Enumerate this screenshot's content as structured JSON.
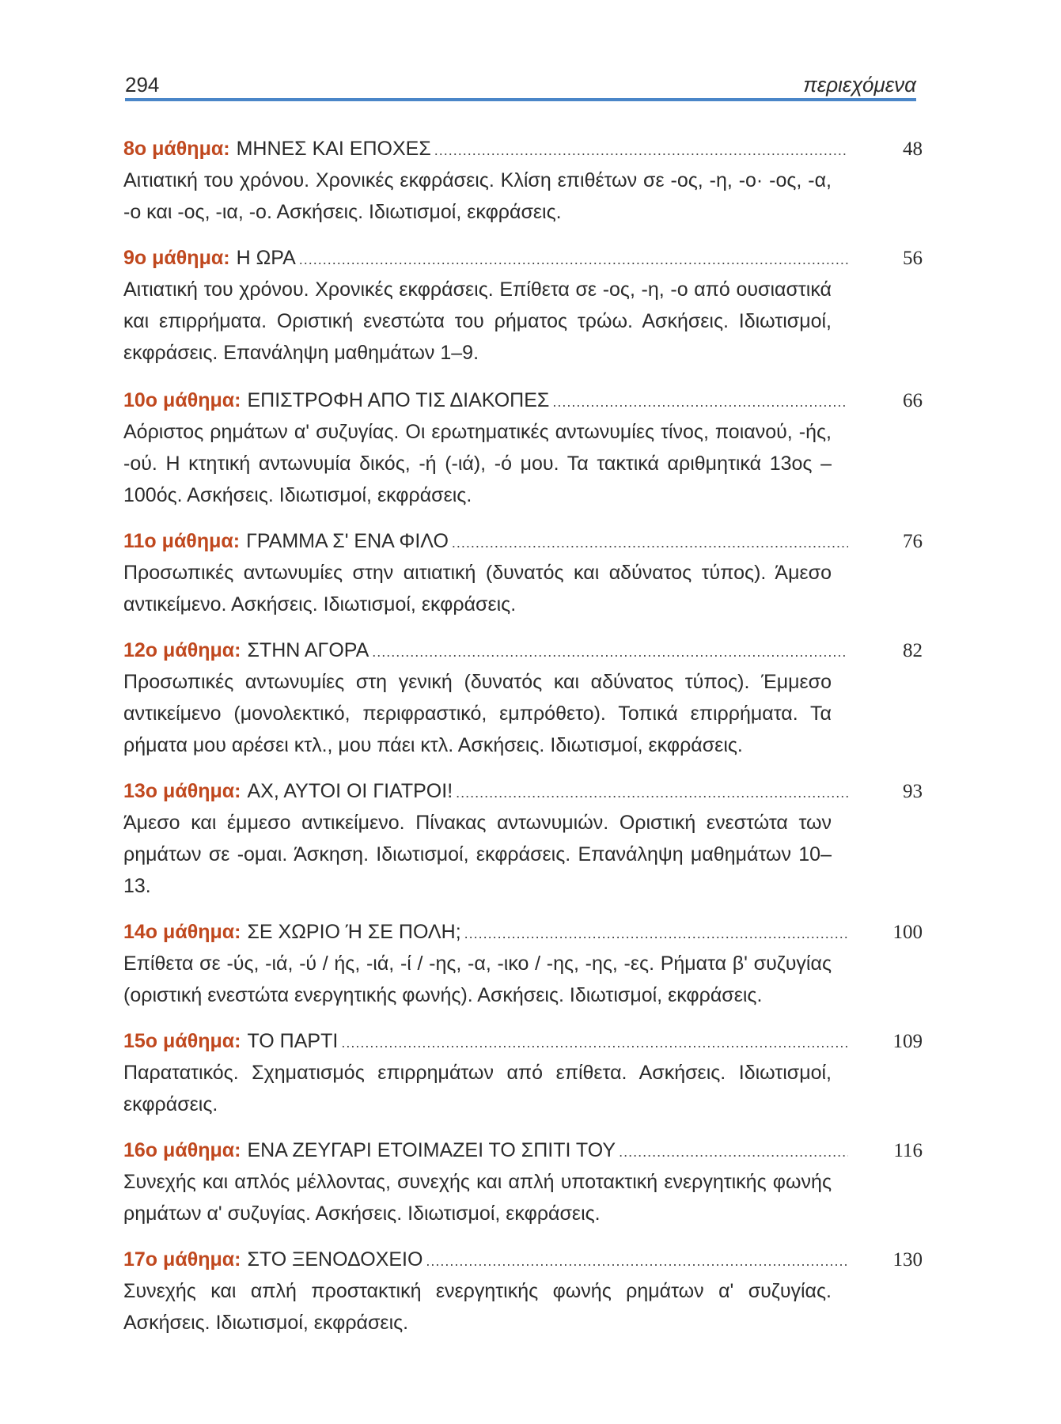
{
  "header": {
    "page_number": "294",
    "title": "περιεχόμενα"
  },
  "entries": [
    {
      "lesson": "8ο μάθημα:",
      "title": "ΜΗΝΕΣ ΚΑΙ ΕΠΟΧΕΣ",
      "page": "48",
      "description": "Αιτιατική του χρόνου. Χρονικές εκφράσεις. Κλίση επιθέτων σε -ος, -η, -ο· -ος, -α, -ο και -ος, -ια, -ο. Ασκήσεις. Ιδιωτισμοί, εκφράσεις."
    },
    {
      "lesson": "9ο μάθημα:",
      "title": "Η ΩΡΑ",
      "page": "56",
      "description": "Αιτιατική του χρόνου. Χρονικές εκφράσεις. Επίθετα σε -ος, -η, -ο από ουσιαστικά και επιρρήματα. Οριστική ενεστώτα του ρήματος τρώω. Ασκήσεις. Ιδιωτισμοί, εκφράσεις. Επανάληψη μαθημάτων 1–9."
    },
    {
      "lesson": "10ο μάθημα:",
      "title": "ΕΠΙΣΤΡΟΦΗ ΑΠΟ ΤΙΣ ΔΙΑΚΟΠΕΣ",
      "page": "66",
      "description": "Αόριστος ρημάτων α' συζυγίας. Οι ερωτηματικές αντωνυμίες τίνος, ποιανού, -ής, -ού. Η κτητική αντωνυμία δικός, -ή (-ιά), -ό μου. Τα τακτικά αριθμητικά 13ος – 100ός. Ασκήσεις. Ιδιωτισμοί, εκφράσεις."
    },
    {
      "lesson": "11ο μάθημα:",
      "title": "ΓΡΑΜΜΑ Σ' ΕΝΑ ΦΙΛΟ",
      "page": "76",
      "description": "Προσωπικές αντωνυμίες στην αιτιατική (δυνατός και αδύνατος τύπος). Άμεσο αντικείμενο. Ασκήσεις. Ιδιωτισμοί, εκφράσεις."
    },
    {
      "lesson": "12ο μάθημα:",
      "title": "ΣΤΗΝ ΑΓΟΡΑ",
      "page": "82",
      "description": "Προσωπικές αντωνυμίες στη γενική (δυνατός και αδύνατος τύπος). Έμμεσο αντικείμενο (μονολεκτικό, περιφραστικό, εμπρόθετο). Τοπικά επιρρήματα. Τα ρήματα μου αρέσει κτλ., μου πάει κτλ. Ασκήσεις. Ιδιωτισμοί, εκφράσεις."
    },
    {
      "lesson": "13ο μάθημα:",
      "title": "ΑΧ, ΑΥΤΟΙ ΟΙ ΓΙΑΤΡΟΙ!",
      "page": "93",
      "description": "Άμεσο και έμμεσο αντικείμενο. Πίνακας αντωνυμιών. Οριστική ενεστώτα των ρημάτων σε -ομαι. Άσκηση. Ιδιωτισμοί, εκφράσεις. Επανάληψη μαθημάτων 10–13."
    },
    {
      "lesson": "14ο μάθημα:",
      "title": "ΣΕ ΧΩΡΙΟ Ή ΣΕ ΠΟΛΗ;",
      "page": "100",
      "description": "Επίθετα σε -ύς, -ιά, -ύ / ής, -ιά, -ί / -ης, -α, -ικο / -ης, -ης, -ες. Ρήματα β' συζυγίας (οριστική ενεστώτα ενεργητικής φωνής). Ασκήσεις. Ιδιωτισμοί, εκφράσεις."
    },
    {
      "lesson": "15ο μάθημα:",
      "title": "ΤΟ ΠΑΡΤΙ",
      "page": "109",
      "description": "Παρατατικός. Σχηματισμός επιρρημάτων από επίθετα. Ασκήσεις. Ιδιωτισμοί, εκφράσεις."
    },
    {
      "lesson": "16ο μάθημα:",
      "title": "ΕΝΑ ΖΕΥΓΑΡΙ ΕΤΟΙΜΑΖΕΙ ΤΟ ΣΠΙΤΙ ΤΟΥ",
      "page": "116",
      "description": "Συνεχής και απλός μέλλοντας, συνεχής και απλή υποτακτική ενεργητικής φωνής ρημάτων α' συζυγίας. Ασκήσεις. Ιδιωτισμοί, εκφράσεις."
    },
    {
      "lesson": "17ο μάθημα:",
      "title": "ΣΤΟ ΞΕΝΟΔΟΧΕΙΟ",
      "page": "130",
      "description": "Συνεχής και απλή προστακτική ενεργητικής φωνής ρημάτων α' συζυγίας. Ασκήσεις. Ιδιωτισμοί, εκφράσεις."
    }
  ]
}
